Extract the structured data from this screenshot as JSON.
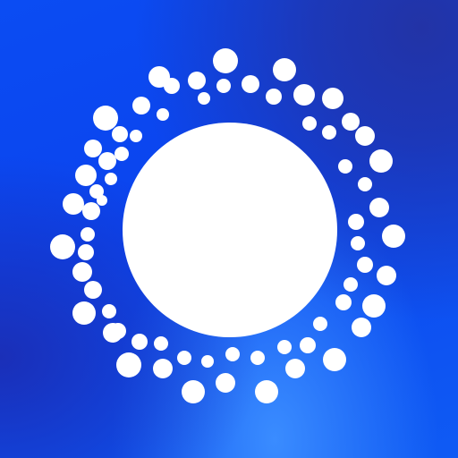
{
  "icon": {
    "name": "sunburst-dots-logo",
    "background_color": "#0b44ee",
    "foreground_color": "#ffffff"
  }
}
